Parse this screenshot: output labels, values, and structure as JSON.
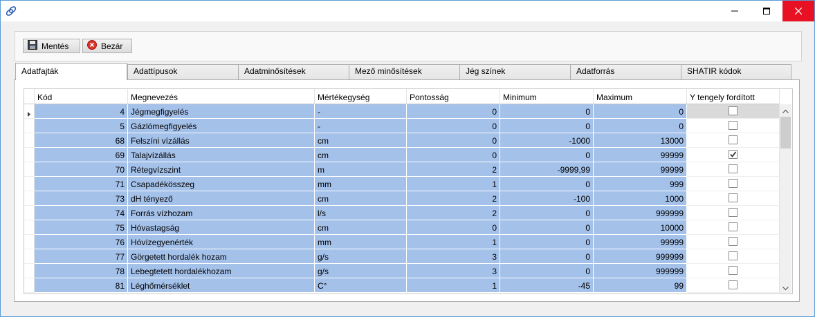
{
  "toolbar": {
    "save_label": "Mentés",
    "close_label": "Bezár"
  },
  "tabs": [
    {
      "label": "Adatfajták"
    },
    {
      "label": "Adattípusok"
    },
    {
      "label": "Adatminősítések"
    },
    {
      "label": "Mező minősítések"
    },
    {
      "label": "Jég színek"
    },
    {
      "label": "Adatforrás"
    },
    {
      "label": "SHATIR kódok"
    }
  ],
  "grid": {
    "columns": [
      "Kód",
      "Megnevezés",
      "Mértékegység",
      "Pontosság",
      "Minimum",
      "Maximum",
      "Y tengely fordított"
    ],
    "rows": [
      {
        "kod": "4",
        "nev": "Jégmegfigyelés",
        "me": "-",
        "pont": "0",
        "min": "0",
        "max": "0",
        "inv": false
      },
      {
        "kod": "5",
        "nev": "Gázlómegfigyelés",
        "me": "-",
        "pont": "0",
        "min": "0",
        "max": "0",
        "inv": false
      },
      {
        "kod": "68",
        "nev": "Felszíni vízállás",
        "me": "cm",
        "pont": "0",
        "min": "-1000",
        "max": "13000",
        "inv": false
      },
      {
        "kod": "69",
        "nev": "Talajvízállás",
        "me": "cm",
        "pont": "0",
        "min": "0",
        "max": "99999",
        "inv": true
      },
      {
        "kod": "70",
        "nev": "Rétegvízszint",
        "me": "m",
        "pont": "2",
        "min": "-9999,99",
        "max": "99999",
        "inv": false
      },
      {
        "kod": "71",
        "nev": "Csapadékösszeg",
        "me": "mm",
        "pont": "1",
        "min": "0",
        "max": "999",
        "inv": false
      },
      {
        "kod": "73",
        "nev": "dH tényező",
        "me": "cm",
        "pont": "2",
        "min": "-100",
        "max": "1000",
        "inv": false
      },
      {
        "kod": "74",
        "nev": "Forrás vízhozam",
        "me": "l/s",
        "pont": "2",
        "min": "0",
        "max": "999999",
        "inv": false
      },
      {
        "kod": "75",
        "nev": "Hóvastagság",
        "me": "cm",
        "pont": "0",
        "min": "0",
        "max": "10000",
        "inv": false
      },
      {
        "kod": "76",
        "nev": "Hóvízegyenérték",
        "me": "mm",
        "pont": "1",
        "min": "0",
        "max": "99999",
        "inv": false
      },
      {
        "kod": "77",
        "nev": "Görgetett hordalék hozam",
        "me": "g/s",
        "pont": "3",
        "min": "0",
        "max": "999999",
        "inv": false
      },
      {
        "kod": "78",
        "nev": "Lebegtetett hordalékhozam",
        "me": "g/s",
        "pont": "3",
        "min": "0",
        "max": "999999",
        "inv": false
      },
      {
        "kod": "81",
        "nev": "Léghőmérséklet",
        "me": "C°",
        "pont": "1",
        "min": "-45",
        "max": "99",
        "inv": false
      }
    ]
  },
  "colors": {
    "selection": "#a4c1ea",
    "close": "#e81123",
    "window_border": "#5a9bd6"
  }
}
